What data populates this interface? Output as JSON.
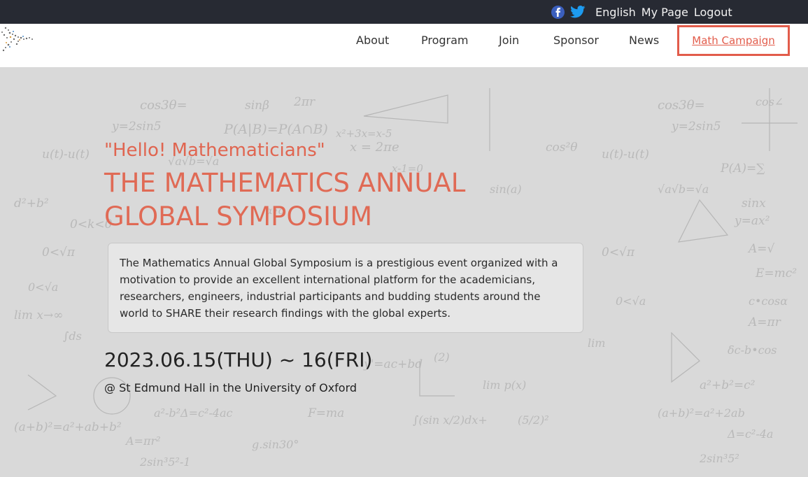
{
  "topbar": {
    "facebook_icon": "facebook-icon",
    "twitter_icon": "twitter-icon",
    "language": "English",
    "my_page": "My Page",
    "logout": "Logout"
  },
  "nav": {
    "items": [
      "About",
      "Program",
      "Join",
      "Sponsor",
      "News"
    ],
    "campaign": "Math Campaign"
  },
  "hero": {
    "greeting": "\"Hello! Mathematicians\"",
    "title": "THE MATHEMATICS ANNUAL GLOBAL SYMPOSIUM",
    "description": "The Mathematics Annual Global Symposium is a prestigious event organized with a motivation to provide an excellent international platform for the academicians, researchers, engineers, industrial participants and budding students around the world to SHARE their research findings with the global experts.",
    "date": "2023.06.15(THU) ~ 16(FRI)",
    "venue": "@ St Edmund Hall in the University of Oxford"
  },
  "colors": {
    "accent": "#e25c4b",
    "topbar": "#272a33"
  }
}
